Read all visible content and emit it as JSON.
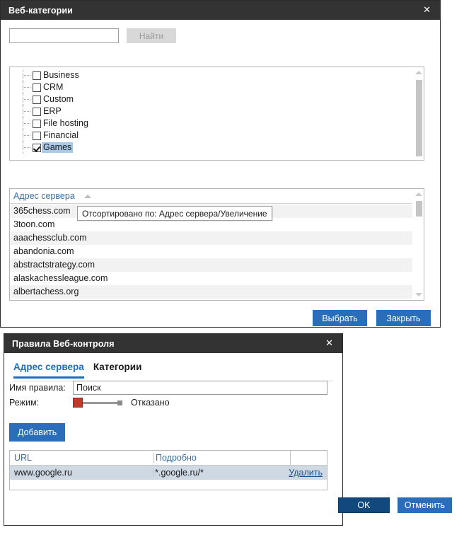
{
  "colors": {
    "titlebar_bg": "#333333",
    "accent_blue": "#2a6ebb",
    "ok_blue": "#11497e",
    "link_blue": "#3a6ea5",
    "selection_blue": "#a9c9e8",
    "row_selected_blue": "#cfd9e4",
    "slider_red": "#c0392b",
    "disabled_gray": "#d8d8d8"
  },
  "categories_dialog": {
    "title": "Веб-категории",
    "close_icon": "close-icon",
    "search": {
      "value": "",
      "placeholder": "",
      "find_label": "Найти",
      "find_disabled": true
    },
    "tree": {
      "items": [
        {
          "label": "Business",
          "checked": false,
          "selected": false
        },
        {
          "label": "CRM",
          "checked": false,
          "selected": false
        },
        {
          "label": "Custom",
          "checked": false,
          "selected": false
        },
        {
          "label": "ERP",
          "checked": false,
          "selected": false
        },
        {
          "label": "File hosting",
          "checked": false,
          "selected": false
        },
        {
          "label": "Financial",
          "checked": false,
          "selected": false
        },
        {
          "label": "Games",
          "checked": true,
          "selected": true
        }
      ]
    },
    "server_grid": {
      "column_header": "Адрес сервера",
      "sort_icon": "sort-ascending-icon",
      "rows": [
        "365chess.com",
        "3toon.com",
        "aaachessclub.com",
        "abandonia.com",
        "abstractstrategy.com",
        "alaskachessleague.com",
        "albertachess.org"
      ]
    },
    "tooltip": "Отсортировано по: Адрес сервера/Увеличение",
    "buttons": {
      "select_label": "Выбрать",
      "close_label": "Закрыть"
    },
    "scrollbars": {
      "up_icon": "scroll-up-arrow-icon",
      "down_icon": "scroll-down-arrow-icon"
    }
  },
  "rules_dialog": {
    "title": "Правила Веб-контроля",
    "close_icon": "close-icon",
    "tabs": [
      {
        "label": "Адрес сервера",
        "active": true
      },
      {
        "label": "Категории",
        "active": false
      }
    ],
    "rule_name": {
      "label": "Имя правила:",
      "value": "Поиск",
      "placeholder": ""
    },
    "mode": {
      "label": "Режим:",
      "value": "Отказано"
    },
    "add_button": "Добавить",
    "url_table": {
      "columns": [
        "URL",
        "Подробно",
        ""
      ],
      "rows": [
        {
          "url": "www.google.ru",
          "detail": "*.google.ru/*",
          "action": "Удалить"
        }
      ]
    },
    "buttons": {
      "ok_label": "OK",
      "cancel_label": "Отменить"
    }
  }
}
